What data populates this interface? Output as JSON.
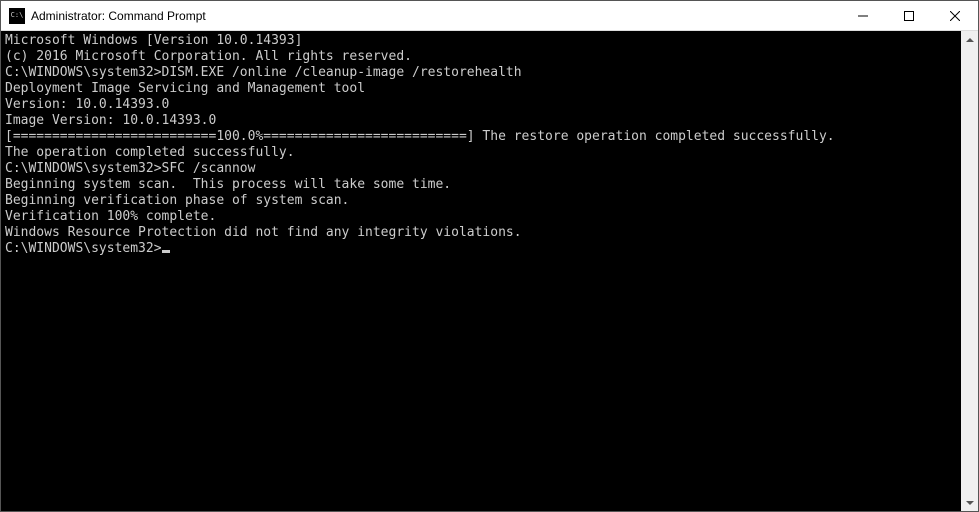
{
  "titlebar": {
    "title": "Administrator: Command Prompt"
  },
  "console": {
    "lines": [
      "Microsoft Windows [Version 10.0.14393]",
      "(c) 2016 Microsoft Corporation. All rights reserved.",
      "",
      "C:\\WINDOWS\\system32>DISM.EXE /online /cleanup-image /restorehealth",
      "",
      "Deployment Image Servicing and Management tool",
      "Version: 10.0.14393.0",
      "",
      "Image Version: 10.0.14393.0",
      "",
      "[==========================100.0%==========================] The restore operation completed successfully.",
      "The operation completed successfully.",
      "",
      "C:\\WINDOWS\\system32>SFC /scannow",
      "",
      "Beginning system scan.  This process will take some time.",
      "",
      "Beginning verification phase of system scan.",
      "Verification 100% complete.",
      "",
      "Windows Resource Protection did not find any integrity violations.",
      "",
      "C:\\WINDOWS\\system32>"
    ]
  }
}
